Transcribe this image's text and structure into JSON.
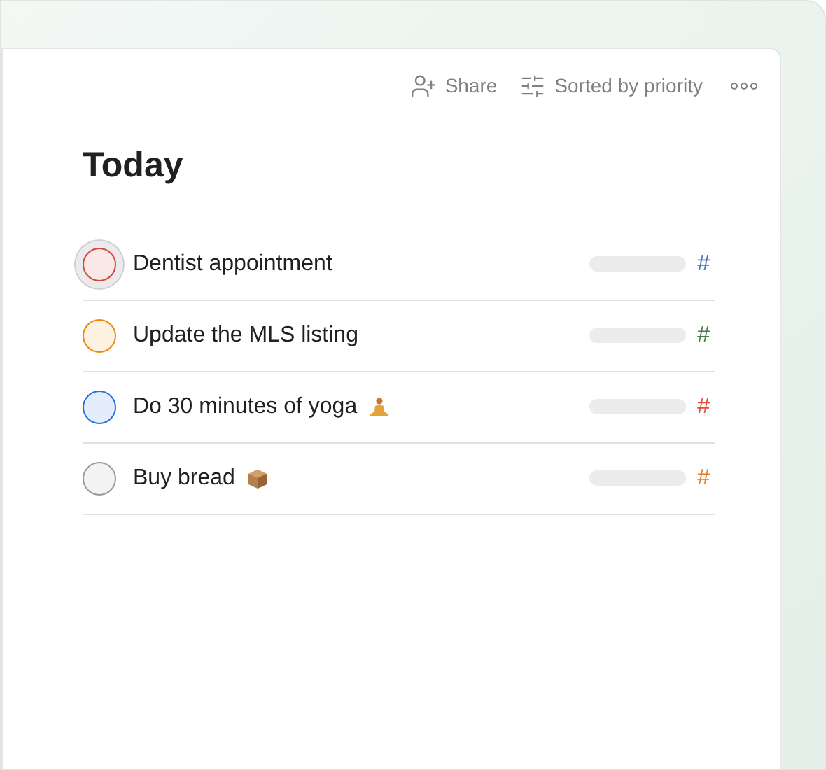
{
  "toolbar": {
    "share": "Share",
    "sort": "Sorted by priority"
  },
  "title": "Today",
  "tasks": [
    {
      "kind": "plain",
      "text": "Dentist appointment",
      "hovered": true,
      "checkbox": {
        "color": "#d1453b"
      },
      "tag": {
        "text": "#",
        "color": "#4073b8"
      }
    },
    {
      "kind": "plain",
      "text": "Update the MLS listing",
      "hovered": false,
      "checkbox": {
        "color": "#eb8909"
      },
      "tag": {
        "text": "#",
        "color": "#4c7a4f"
      }
    },
    {
      "kind": "yoga",
      "text": "Do 30 minutes of yoga",
      "hovered": false,
      "checkbox": {
        "color": "#246fe0"
      },
      "tag": {
        "text": "#",
        "color": "#e04b3a"
      }
    },
    {
      "kind": "parcel",
      "text": "Buy bread",
      "hovered": false,
      "checkbox": {
        "color": "#999999"
      },
      "tag": {
        "text": "#",
        "color": "#d9822b"
      }
    }
  ]
}
